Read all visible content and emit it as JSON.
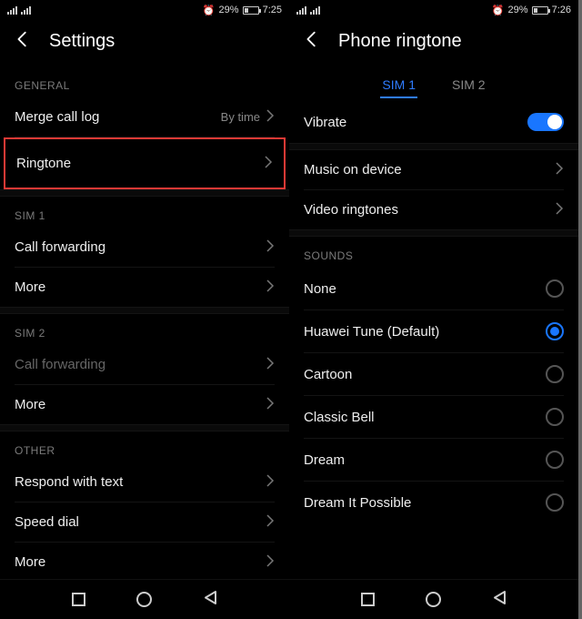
{
  "left": {
    "status": {
      "battery": "29%",
      "time": "7:25"
    },
    "title": "Settings",
    "sections": {
      "general_header": "GENERAL",
      "merge_call_log": {
        "label": "Merge call log",
        "value": "By time"
      },
      "ringtone": {
        "label": "Ringtone"
      },
      "sim1_header": "SIM 1",
      "sim1_forwarding": "Call forwarding",
      "sim1_more": "More",
      "sim2_header": "SIM 2",
      "sim2_forwarding": "Call forwarding",
      "sim2_more": "More",
      "other_header": "OTHER",
      "respond": "Respond with text",
      "speed_dial": "Speed dial",
      "other_more": "More"
    }
  },
  "right": {
    "status": {
      "battery": "29%",
      "time": "7:26"
    },
    "title": "Phone ringtone",
    "tabs": {
      "sim1": "SIM 1",
      "sim2": "SIM 2"
    },
    "vibrate": "Vibrate",
    "music": "Music on device",
    "video": "Video ringtones",
    "sounds_header": "SOUNDS",
    "sounds": [
      {
        "label": "None",
        "selected": false
      },
      {
        "label": "Huawei Tune (Default)",
        "selected": true
      },
      {
        "label": "Cartoon",
        "selected": false
      },
      {
        "label": "Classic Bell",
        "selected": false
      },
      {
        "label": "Dream",
        "selected": false
      },
      {
        "label": "Dream It Possible",
        "selected": false
      }
    ]
  }
}
